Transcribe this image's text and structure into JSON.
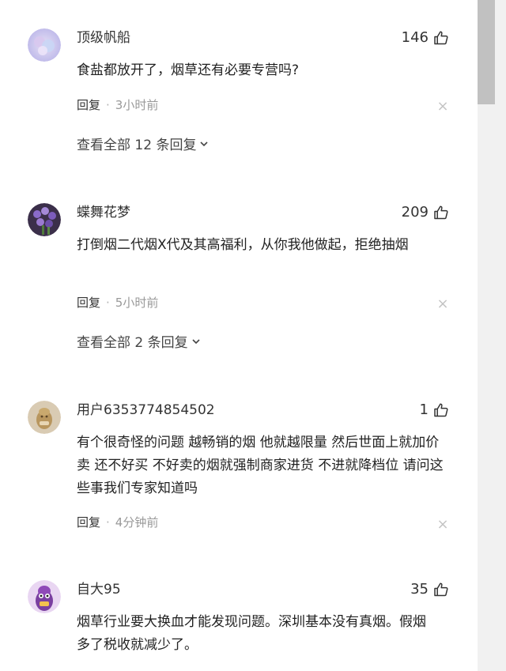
{
  "comments": [
    {
      "username": "顶级帆船",
      "likes": "146",
      "content": "食盐都放开了，烟草还有必要专营吗?",
      "reply_label": "回复",
      "time": "3小时前",
      "expand_label": "查看全部 12 条回复"
    },
    {
      "username": "蝶舞花梦",
      "likes": "209",
      "content": "打倒烟二代烟X代及其高福利，从你我他做起，拒绝抽烟",
      "reply_label": "回复",
      "time": "5小时前",
      "expand_label": "查看全部 2 条回复"
    },
    {
      "username": "用户6353774854502",
      "likes": "1",
      "content": "有个很奇怪的问题 越畅销的烟 他就越限量 然后世面上就加价卖 还不好买 不好卖的烟就强制商家进货 不进就降档位 请问这些事我们专家知道吗",
      "reply_label": "回复",
      "time": "4分钟前"
    },
    {
      "username": "自大95",
      "likes": "35",
      "content": "烟草行业要大换血才能发现问题。深圳基本没有真烟。假烟多了税收就减少了。"
    }
  ],
  "icons": {
    "like": "thumbs-up-icon",
    "close": "close-icon",
    "chevron": "chevron-down-icon"
  },
  "colors": {
    "text": "#222222",
    "meta": "#999999",
    "scrollbar_thumb": "#c1c1c1"
  }
}
